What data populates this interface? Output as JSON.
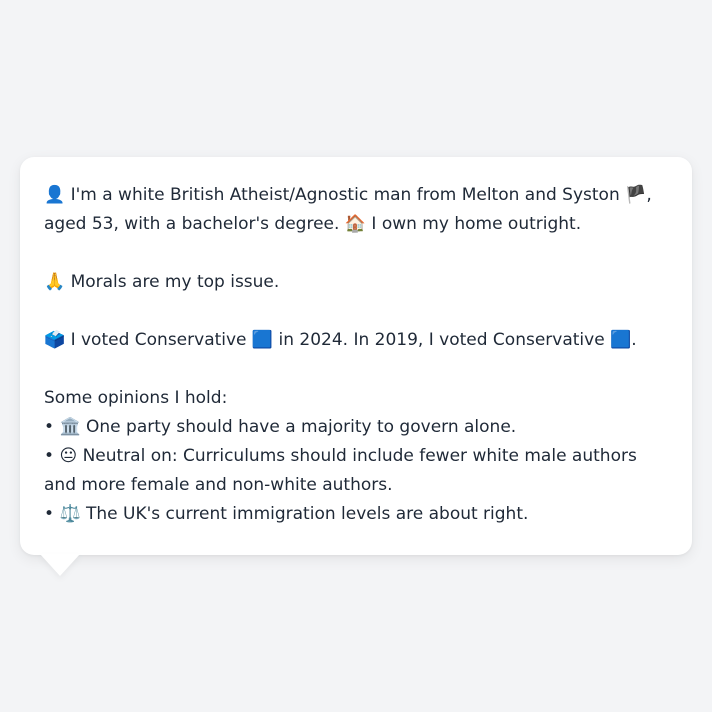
{
  "profile": {
    "intro_icon": "👤",
    "intro_a": "I'm a white British Atheist/Agnostic man from Melton and Syston",
    "flag_icon": "🏴",
    "intro_b": ", aged 53, with a bachelor's degree.",
    "home_icon": "🏠",
    "intro_c": "I own my home outright.",
    "morals_icon": "🙏",
    "morals_text": "Morals are my top issue.",
    "vote_icon": "🗳️",
    "vote_a": "I voted Conservative",
    "party_icon_1": "🟦",
    "vote_b": "in 2024. In 2019, I voted Conservative",
    "party_icon_2": "🟦",
    "vote_c": "."
  },
  "opinions": {
    "heading": "Some opinions I hold:",
    "bullet": "•",
    "items": [
      {
        "icon": "🏛️",
        "text": "One party should have a majority to govern alone."
      },
      {
        "icon": "😐",
        "text": "Neutral on: Curriculums should include fewer white male authors and more female and non-white authors."
      },
      {
        "icon": "⚖️",
        "text": "The UK's current immigration levels are about right."
      }
    ]
  }
}
